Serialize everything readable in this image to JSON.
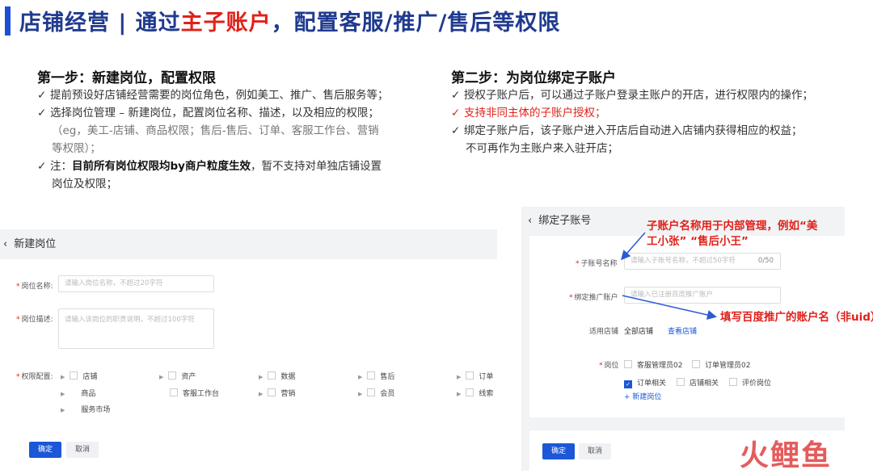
{
  "header": {
    "title_part1": "店铺经营 | 通过",
    "title_red": "主子账户",
    "title_part2": "，配置客服/推广/售后等权限"
  },
  "step1": {
    "title": "第一步：新建岗位，配置权限",
    "b1": "提前预设好店铺经营需要的岗位角色，例如美工、推广、售后服务等；",
    "b2": "选择岗位管理 – 新建岗位，配置岗位名称、描述，以及相应的权限；",
    "b2_sub1": "（eg，美工-店铺、商品权限；售后-售后、订单、客服工作台、营销",
    "b2_sub2": "等权限）；",
    "b3_prefix": "注：",
    "b3_bold": "目前所有岗位权限均by商户粒度生效",
    "b3_suffix": "，暂不支持对单独店铺设置",
    "b3_line2": "岗位及权限；"
  },
  "step2": {
    "title": "第二步：为岗位绑定子账户",
    "b1": "授权子账户后，可以通过子账户登录主账户的开店，进行权限内的操作；",
    "b2": "支持非同主体的子账户授权；",
    "b3": "绑定子账户后，该子账户进入开店后自动进入店铺内获得相应的权益；",
    "b3_line2": "不可再作为主账户来入驻开店；"
  },
  "check_icon": "✓",
  "left_form": {
    "header": "新建岗位",
    "back_icon": "‹",
    "name_label": "岗位名称:",
    "name_placeholder": "请输入岗位名称，不超过20字符",
    "desc_label": "岗位描述:",
    "desc_placeholder": "请输入该岗位的职责说明，不超过100字符",
    "perm_label": "权限配置:",
    "perms_row1": [
      "店铺",
      "资产",
      "数据",
      "售后",
      "订单"
    ],
    "perms_row2": [
      "商品",
      "客服工作台",
      "营销",
      "会员",
      "线索"
    ],
    "perms_row3": [
      "服务市场"
    ],
    "confirm": "确定",
    "cancel": "取消"
  },
  "right_form": {
    "header": "绑定子账号",
    "back_icon": "‹",
    "sub_label": "子账号名称",
    "sub_placeholder": "请输入子账号名称，不超过50字符",
    "sub_count": "0/50",
    "promo_label": "绑定推广账户",
    "promo_placeholder": "请输入已注册百度推广账户",
    "store_label": "适用店铺",
    "store_value": "全部店铺",
    "store_link": "查看店铺",
    "post_label": "岗位",
    "posts_row1": [
      "客服管理员02",
      "订单管理员02"
    ],
    "posts_row2": [
      "订单相关",
      "店铺相关",
      "评价岗位"
    ],
    "add_post": "+ 新建岗位",
    "confirm": "确定",
    "cancel": "取消"
  },
  "annotations": {
    "note1_l1": "子账户名称用于内部管理，例如“美",
    "note1_l2": "工小张” “售后小王”",
    "note2": "填写百度推广的账户名（非uid）"
  },
  "watermark": "火鲤鱼",
  "colors": {
    "accent": "#1b57d6",
    "red": "#e0211a",
    "title": "#1f3a8f"
  }
}
